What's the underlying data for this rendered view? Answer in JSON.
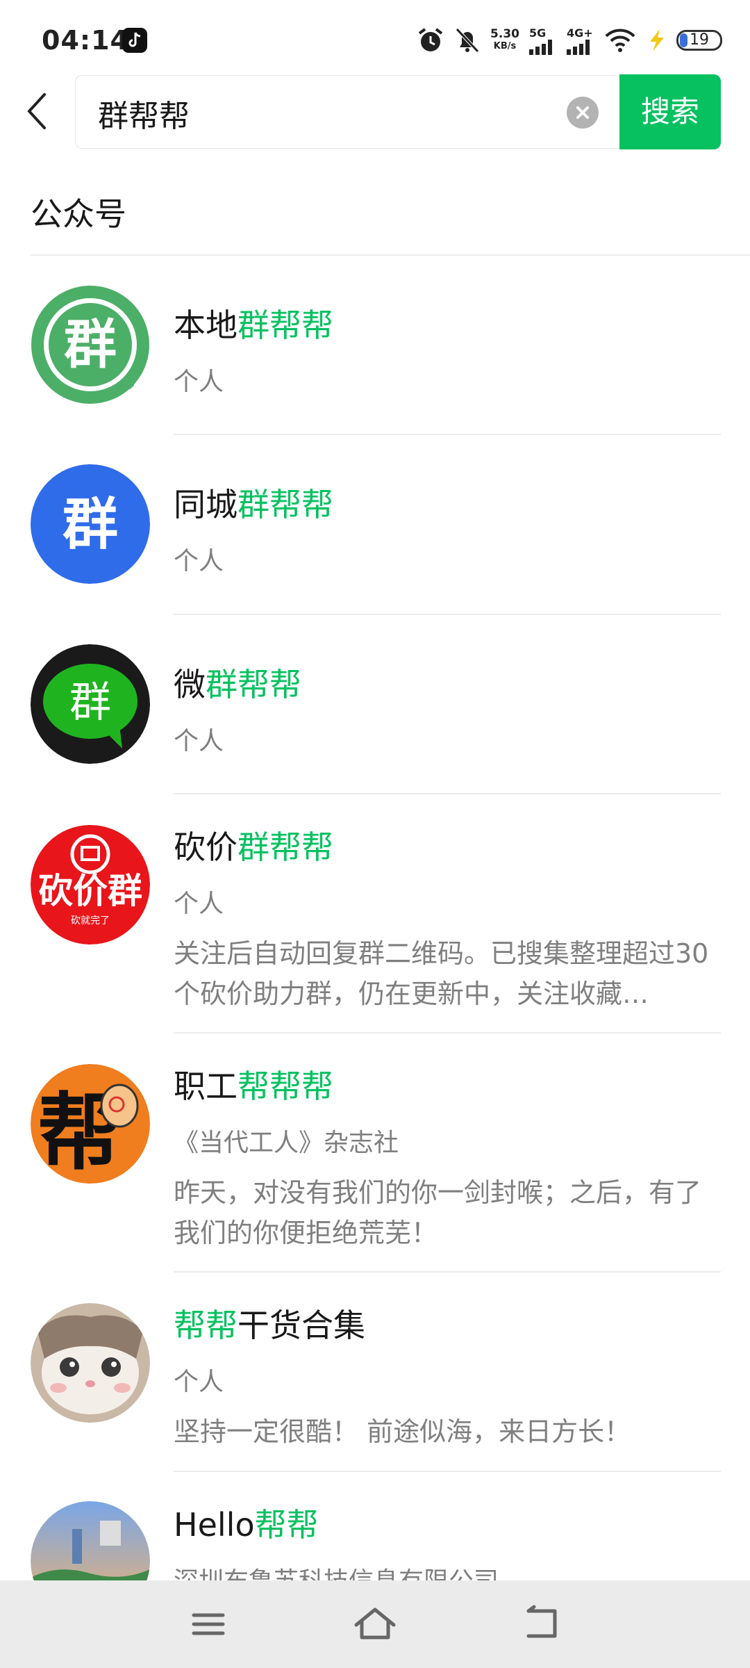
{
  "status_bar": {
    "time": "04:14",
    "net_speed_value": "5.30",
    "net_speed_unit": "KB/s",
    "sim1": "5G",
    "sim2": "4G+",
    "battery": "19",
    "battery_color": "#3a6fd8"
  },
  "search": {
    "query": "群帮帮",
    "button_label": "搜索"
  },
  "section": {
    "title": "公众号"
  },
  "results": [
    {
      "name_prefix": "本地",
      "name_highlight": "群帮帮",
      "name_suffix": "",
      "sub": "个人",
      "desc": ""
    },
    {
      "name_prefix": "同城",
      "name_highlight": "群帮帮",
      "name_suffix": "",
      "sub": "个人",
      "desc": ""
    },
    {
      "name_prefix": "微",
      "name_highlight": "群帮帮",
      "name_suffix": "",
      "sub": "个人",
      "desc": ""
    },
    {
      "name_prefix": "砍价",
      "name_highlight": "群帮帮",
      "name_suffix": "",
      "sub": "个人",
      "desc": "关注后自动回复群二维码。已搜集整理超过30个砍价助力群，仍在更新中，关注收藏…"
    },
    {
      "name_prefix": "职工",
      "name_highlight": "帮帮帮",
      "name_suffix": "",
      "sub": "《当代工人》杂志社",
      "desc": "昨天，对没有我们的你一剑封喉；之后，有了我们的你便拒绝荒芜！"
    },
    {
      "name_prefix": "",
      "name_highlight": "帮帮",
      "name_suffix": "干货合集",
      "sub": "个人",
      "desc": "坚持一定很酷！ 前途似海，来日方长！"
    },
    {
      "name_prefix": "Hello",
      "name_highlight": "帮帮",
      "name_suffix": "",
      "sub": "深圳布鲁苏科技信息有限公司",
      "desc": ""
    }
  ],
  "avatars": {
    "a1_text": "群",
    "a1_color": "#4caf67",
    "a2_text": "群",
    "a2_color": "#2f6ce9",
    "a3_text": "群",
    "a3_color": "#1a1a1a",
    "a3_bubble": "#1fb41f",
    "a4_text": "砍价群",
    "a4_sub": "砍就完了",
    "a4_color": "#e8151b",
    "a5_text": "帮",
    "a5_color": "#f07d1e"
  },
  "colors": {
    "accent": "#07c160",
    "secondary_text": "#7f7f7f"
  }
}
